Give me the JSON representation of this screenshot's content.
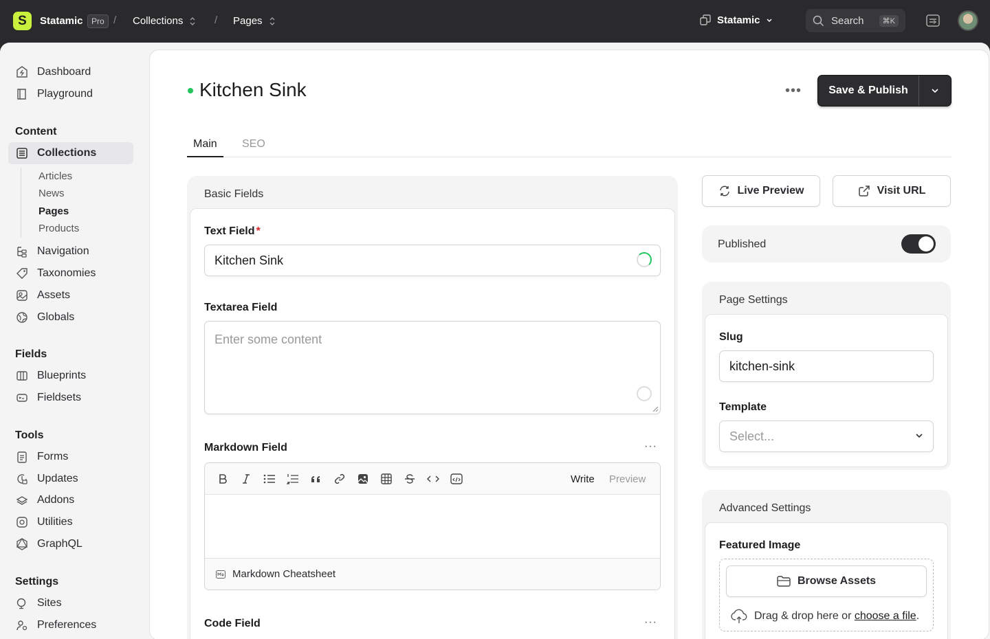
{
  "topbar": {
    "brand": "Statamic",
    "badge": "Pro",
    "crumbs": [
      "Collections",
      "Pages"
    ],
    "site": "Statamic",
    "search_label": "Search",
    "search_shortcut": "⌘K"
  },
  "sidebar": {
    "top": [
      "Dashboard",
      "Playground"
    ],
    "content_heading": "Content",
    "collections": "Collections",
    "sub": [
      "Articles",
      "News",
      "Pages",
      "Products"
    ],
    "content_rest": [
      "Navigation",
      "Taxonomies",
      "Assets",
      "Globals"
    ],
    "fields_heading": "Fields",
    "fields": [
      "Blueprints",
      "Fieldsets"
    ],
    "tools_heading": "Tools",
    "tools": [
      "Forms",
      "Updates",
      "Addons",
      "Utilities",
      "GraphQL"
    ],
    "settings_heading": "Settings",
    "settings": [
      "Sites",
      "Preferences"
    ]
  },
  "entry": {
    "title": "Kitchen Sink",
    "more": "•••",
    "save_label": "Save & Publish",
    "tabs": [
      "Main",
      "SEO"
    ]
  },
  "basic": {
    "heading": "Basic Fields",
    "text_label": "Text Field",
    "text_required": "*",
    "text_value": "Kitchen Sink",
    "textarea_label": "Textarea Field",
    "textarea_placeholder": "Enter some content",
    "markdown_label": "Markdown Field",
    "markdown_more": "···",
    "md_write": "Write",
    "md_preview": "Preview",
    "md_cheatsheet": "Markdown Cheatsheet",
    "code_label": "Code Field",
    "code_more": "···"
  },
  "side": {
    "live_preview": "Live Preview",
    "visit_url": "Visit URL",
    "published_label": "Published",
    "published": true,
    "page_settings": "Page Settings",
    "slug_label": "Slug",
    "slug_value": "kitchen-sink",
    "template_label": "Template",
    "template_placeholder": "Select...",
    "advanced": "Advanced Settings",
    "featured_label": "Featured Image",
    "browse_assets": "Browse Assets",
    "drop_text": "Drag & drop here or",
    "drop_link": "choose a file",
    "drop_end": "."
  }
}
